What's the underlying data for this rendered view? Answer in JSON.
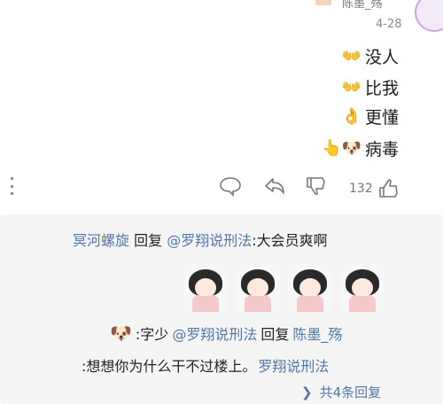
{
  "comment": {
    "username": "陈墨_殇",
    "date": "4-28",
    "lines": [
      {
        "text": "没人",
        "emoji": "👐"
      },
      {
        "text": "比我",
        "emoji": "👐"
      },
      {
        "text": "更懂",
        "emoji": "👌"
      },
      {
        "text": "病毒",
        "emoji": "👆🐶"
      }
    ],
    "like_count": "132"
  },
  "replies": [
    {
      "user": "冥河螺旋",
      "verb": "回复",
      "target": "@罗翔说刑法",
      "text": ":大会员爽啊"
    },
    {
      "user": "陈墨_殇",
      "verb": "回复",
      "target": "@罗翔说刑法",
      "text": ":字少"
    },
    {
      "user": "罗翔说刑法",
      "verb": "",
      "target": "",
      "text": ":想想你为什么干不过楼上。"
    }
  ],
  "more_replies": "共4条回复",
  "colors": {
    "link": "#5278a8",
    "panel": "#f5f5f5"
  }
}
